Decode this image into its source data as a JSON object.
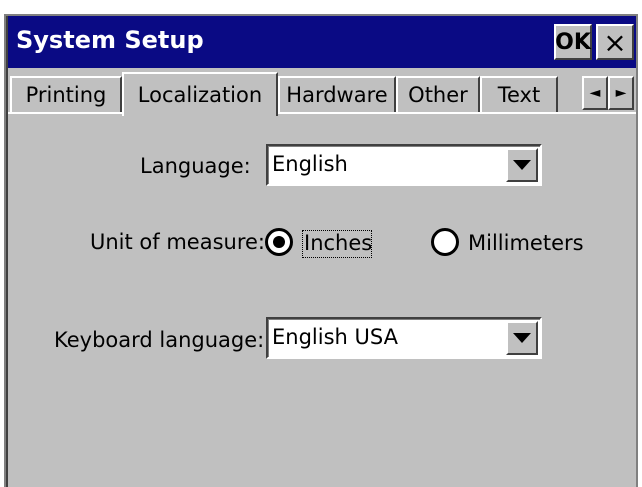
{
  "window": {
    "title": "System Setup",
    "ok_label": "OK",
    "close_label": "×"
  },
  "tabs": [
    {
      "label": "Printing",
      "active": false
    },
    {
      "label": "Localization",
      "active": true
    },
    {
      "label": "Hardware",
      "active": false
    },
    {
      "label": "Other",
      "active": false
    },
    {
      "label": "Text",
      "active": false
    }
  ],
  "tab_scroll": {
    "left": "◄",
    "right": "►"
  },
  "form": {
    "language_label": "Language:",
    "language_value": "English",
    "unit_label": "Unit of measure:",
    "unit_options": [
      {
        "label": "Inches",
        "selected": true
      },
      {
        "label": "Millimeters",
        "selected": false
      }
    ],
    "keyboard_label": "Keyboard language:",
    "keyboard_value": "English USA"
  },
  "colors": {
    "titlebar": "#0a0a84",
    "face": "#c0c0c0"
  }
}
